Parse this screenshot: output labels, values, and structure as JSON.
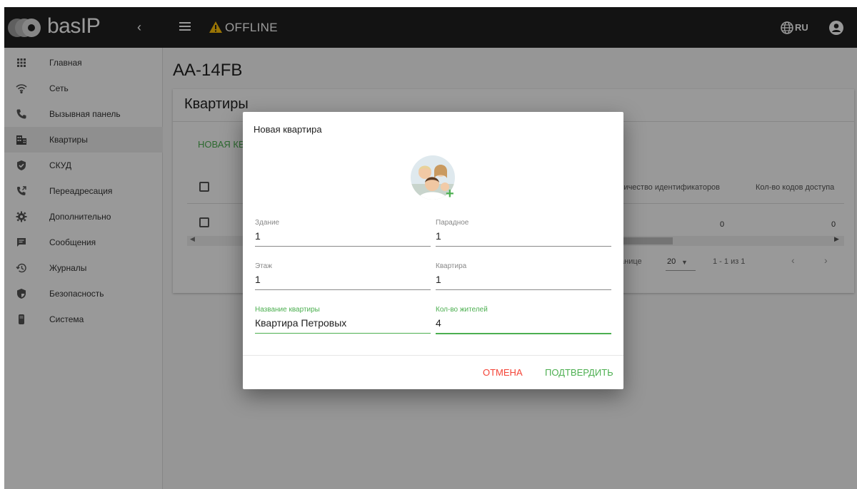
{
  "topbar": {
    "logo_text": "basIP",
    "status_label": "OFFLINE",
    "language": "RU"
  },
  "sidebar": {
    "items": [
      {
        "label": "Главная",
        "icon": "grid-icon"
      },
      {
        "label": "Сеть",
        "icon": "wifi-icon"
      },
      {
        "label": "Вызывная панель",
        "icon": "phone-icon"
      },
      {
        "label": "Квартиры",
        "icon": "building-icon"
      },
      {
        "label": "СКУД",
        "icon": "shield-check-icon"
      },
      {
        "label": "Переадресация",
        "icon": "call-forward-icon"
      },
      {
        "label": "Дополнительно",
        "icon": "gear-icon"
      },
      {
        "label": "Сообщения",
        "icon": "message-icon"
      },
      {
        "label": "Журналы",
        "icon": "history-icon"
      },
      {
        "label": "Безопасность",
        "icon": "security-icon"
      },
      {
        "label": "Система",
        "icon": "device-icon"
      }
    ],
    "active_index": 3
  },
  "main": {
    "page_title": "AA-14FB",
    "card_title": "Квартиры",
    "new_button": "НОВАЯ КВ",
    "columns": [
      "личество идентификаторов",
      "Кол-во кодов доступа"
    ],
    "row": [
      "0",
      "0"
    ],
    "pagination": {
      "label": "анице",
      "per_page": "20",
      "range": "1 - 1 из 1"
    }
  },
  "dialog": {
    "title": "Новая квартира",
    "fields": {
      "building": {
        "label": "Здание",
        "value": "1"
      },
      "entrance": {
        "label": "Парадное",
        "value": "1"
      },
      "floor": {
        "label": "Этаж",
        "value": "1"
      },
      "apartment": {
        "label": "Квартира",
        "value": "1"
      },
      "apt_name": {
        "label": "Название квартиры",
        "value": "Квартира Петровых"
      },
      "residents": {
        "label": "Кол-во жителей",
        "value": "4"
      }
    },
    "cancel_label": "ОТМЕНА",
    "confirm_label": "ПОДТВЕРДИТЬ"
  },
  "colors": {
    "accent": "#4caf50",
    "cancel": "#f44336",
    "topbar": "#212121",
    "warning": "#ffc107"
  }
}
